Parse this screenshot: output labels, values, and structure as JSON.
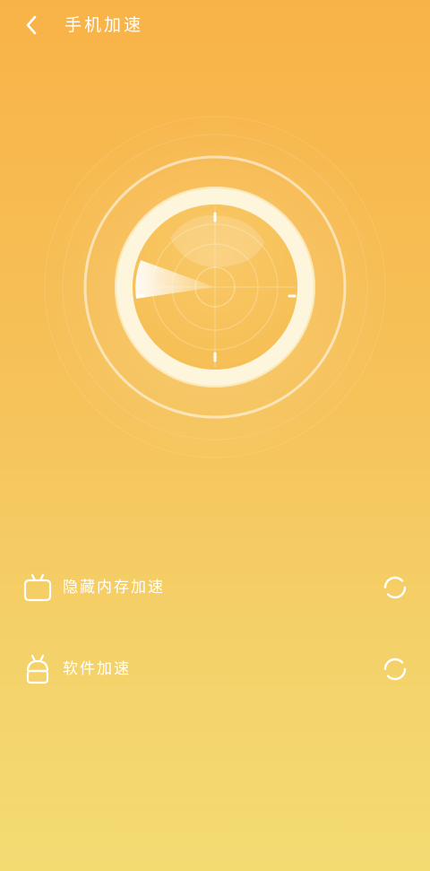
{
  "header": {
    "title": "手机加速",
    "back_icon": "chevron-left-icon"
  },
  "radar": {
    "icon": "radar-scan-icon"
  },
  "items": [
    {
      "label": "隐藏内存加速",
      "icon": "tv-android-icon",
      "status_icon": "loading-spinner-icon"
    },
    {
      "label": "软件加速",
      "icon": "android-robot-icon",
      "status_icon": "loading-spinner-icon"
    }
  ],
  "colors": {
    "gradient_top": "#f8b347",
    "gradient_bottom": "#f3db72",
    "foreground": "#ffffff",
    "ring_fill": "#fdf3d8"
  }
}
